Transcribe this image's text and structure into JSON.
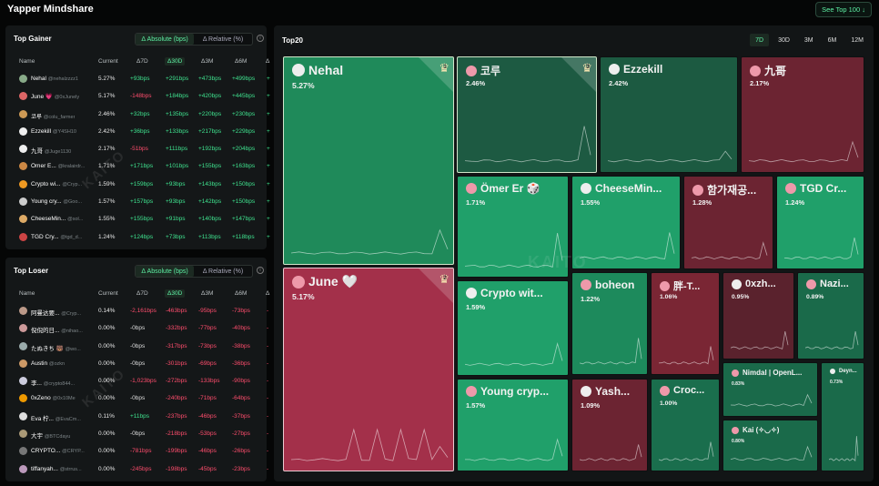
{
  "header": {
    "title": "Yapper Mindshare",
    "see_top": "See Top 100 ↓"
  },
  "gainer": {
    "title": "Top Gainer",
    "toggle": [
      "Δ Absolute (bps)",
      "Δ Relative (%)"
    ],
    "cols": [
      "Name",
      "Current",
      "Δ7D",
      "Δ30D",
      "Δ3M",
      "Δ6M",
      "Δ"
    ],
    "rows": [
      {
        "name": "Nehal",
        "handle": "@nehalzzzz1",
        "cur": "5.27%",
        "d7": "+93bps",
        "d30": "+291bps",
        "d3m": "+473bps",
        "d6m": "+499bps",
        "c7": "g"
      },
      {
        "name": "June 💗",
        "handle": "@0xJunely",
        "cur": "5.17%",
        "d7": "-148bps",
        "d30": "+184bps",
        "d3m": "+420bps",
        "d6m": "+445bps",
        "c7": "r"
      },
      {
        "name": "코루",
        "handle": "@colu_farmer",
        "cur": "2.46%",
        "d7": "+32bps",
        "d30": "+135bps",
        "d3m": "+220bps",
        "d6m": "+230bps",
        "c7": "g"
      },
      {
        "name": "Ezzekill",
        "handle": "@Y4SH10",
        "cur": "2.42%",
        "d7": "+36bps",
        "d30": "+133bps",
        "d3m": "+217bps",
        "d6m": "+229bps",
        "c7": "g"
      },
      {
        "name": "九哥",
        "handle": "@Juge1130",
        "cur": "2.17%",
        "d7": "-51bps",
        "d30": "+111bps",
        "d3m": "+192bps",
        "d6m": "+204bps",
        "c7": "r"
      },
      {
        "name": "Ömer E...",
        "handle": "@kralairdr...",
        "cur": "1.71%",
        "d7": "+171bps",
        "d30": "+101bps",
        "d3m": "+155bps",
        "d6m": "+163bps",
        "c7": "g"
      },
      {
        "name": "Crypto wi...",
        "handle": "@Cryp...",
        "cur": "1.59%",
        "d7": "+159bps",
        "d30": "+93bps",
        "d3m": "+143bps",
        "d6m": "+150bps",
        "c7": "g"
      },
      {
        "name": "Young cry...",
        "handle": "@Goo...",
        "cur": "1.57%",
        "d7": "+157bps",
        "d30": "+93bps",
        "d3m": "+142bps",
        "d6m": "+150bps",
        "c7": "g"
      },
      {
        "name": "CheeseMin...",
        "handle": "@sol...",
        "cur": "1.55%",
        "d7": "+155bps",
        "d30": "+91bps",
        "d3m": "+140bps",
        "d6m": "+147bps",
        "c7": "g"
      },
      {
        "name": "TGD Cry...",
        "handle": "@tgd_d...",
        "cur": "1.24%",
        "d7": "+124bps",
        "d30": "+73bps",
        "d3m": "+113bps",
        "d6m": "+118bps",
        "c7": "g"
      }
    ]
  },
  "loser": {
    "title": "Top Loser",
    "toggle": [
      "Δ Absolute (bps)",
      "Δ Relative (%)"
    ],
    "cols": [
      "Name",
      "Current",
      "Δ7D",
      "Δ30D",
      "Δ3M",
      "Δ6M",
      "Δ"
    ],
    "rows": [
      {
        "name": "阿曼达要...",
        "handle": "@Cryp...",
        "cur": "0.14%",
        "d7": "-2,161bps",
        "d30": "-463bps",
        "d3m": "-95bps",
        "d6m": "-73bps",
        "c7": "r"
      },
      {
        "name": "倪倪的日...",
        "handle": "@nihao...",
        "cur": "0.00%",
        "d7": "-0bps",
        "d30": "-332bps",
        "d3m": "-77bps",
        "d6m": "-40bps",
        "c7": "w"
      },
      {
        "name": "たぬきち 🐻",
        "handle": "@wo...",
        "cur": "0.00%",
        "d7": "-0bps",
        "d30": "-317bps",
        "d3m": "-73bps",
        "d6m": "-38bps",
        "c7": "w"
      },
      {
        "name": "Austin",
        "handle": "@ozkn",
        "cur": "0.00%",
        "d7": "-0bps",
        "d30": "-301bps",
        "d3m": "-69bps",
        "d6m": "-36bps",
        "c7": "w"
      },
      {
        "name": "李...",
        "handle": "@crypto844...",
        "cur": "0.00%",
        "d7": "-1,023bps",
        "d30": "-272bps",
        "d3m": "-133bps",
        "d6m": "-90bps",
        "c7": "r"
      },
      {
        "name": "0xZeno",
        "handle": "@0x10Me",
        "cur": "0.00%",
        "d7": "-0bps",
        "d30": "-240bps",
        "d3m": "-71bps",
        "d6m": "-64bps",
        "c7": "w"
      },
      {
        "name": "Eva 柠...",
        "handle": "@EvaCm...",
        "cur": "0.11%",
        "d7": "+11bps",
        "d30": "-237bps",
        "d3m": "-46bps",
        "d6m": "-37bps",
        "c7": "g"
      },
      {
        "name": "大宇",
        "handle": "@BTCdayu",
        "cur": "0.00%",
        "d7": "-0bps",
        "d30": "-218bps",
        "d3m": "-53bps",
        "d6m": "-27bps",
        "c7": "w"
      },
      {
        "name": "CRYPTO...",
        "handle": "@CRYP...",
        "cur": "0.00%",
        "d7": "-781bps",
        "d30": "-199bps",
        "d3m": "-46bps",
        "d6m": "-26bps",
        "c7": "r"
      },
      {
        "name": "tiffanyah...",
        "handle": "@strrus...",
        "cur": "0.00%",
        "d7": "-245bps",
        "d30": "-198bps",
        "d3m": "-45bps",
        "d6m": "-23bps",
        "c7": "r"
      }
    ]
  },
  "top20": {
    "title": "Top20",
    "tabs": [
      "7D",
      "30D",
      "3M",
      "6M",
      "12M"
    ],
    "watermark": "KAITO",
    "tiles": [
      {
        "name": "Nehal",
        "pct": "5.27%",
        "rank": "1",
        "color": "#1f8a5a"
      },
      {
        "name": "June 🤍",
        "pct": "5.17%",
        "rank": "2",
        "color": "#a3304a"
      },
      {
        "name": "코루",
        "pct": "2.46%",
        "rank": "3",
        "color": "#1d5a42"
      },
      {
        "name": "Ezzekill",
        "pct": "2.42%",
        "color": "#1c5a41"
      },
      {
        "name": "九哥",
        "pct": "2.17%",
        "color": "#6c2432"
      },
      {
        "name": "Ömer Er 🎲",
        "pct": "1.71%",
        "color": "#20a06a"
      },
      {
        "name": "CheeseMin...",
        "pct": "1.55%",
        "color": "#20a06a"
      },
      {
        "name": "함가재공...",
        "pct": "1.28%",
        "color": "#6c2432"
      },
      {
        "name": "TGD Cr...",
        "pct": "1.24%",
        "color": "#20a06a"
      },
      {
        "name": "Crypto wit...",
        "pct": "1.59%",
        "color": "#20a06a"
      },
      {
        "name": "boheon",
        "pct": "1.22%",
        "color": "#1d8a5c"
      },
      {
        "name": "胖-T...",
        "pct": "1.06%",
        "color": "#7a2634"
      },
      {
        "name": "0xzh...",
        "pct": "0.95%",
        "color": "#5a222d"
      },
      {
        "name": "Nazi...",
        "pct": "0.89%",
        "color": "#1a6a4a"
      },
      {
        "name": "Young cryp...",
        "pct": "1.57%",
        "color": "#20a06a"
      },
      {
        "name": "Yash...",
        "pct": "1.09%",
        "color": "#6c2432"
      },
      {
        "name": "Croc...",
        "pct": "1.00%",
        "color": "#1a6e4d"
      },
      {
        "name": "Nimdal | OpenL...",
        "pct": "0.83%",
        "color": "#1a6a4a"
      },
      {
        "name": "Deyn...",
        "pct": "0.73%",
        "color": "#1a6a4a"
      },
      {
        "name": "Kai (✧◡✧)",
        "pct": "0.80%",
        "color": "#1a6a4a"
      }
    ]
  }
}
